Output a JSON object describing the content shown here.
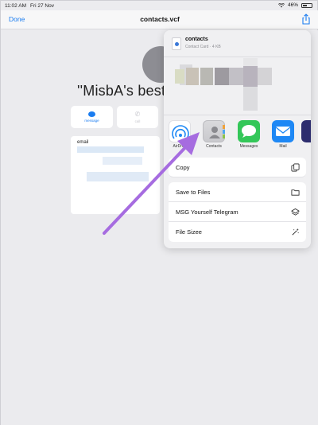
{
  "status_bar": {
    "time": "11:02 AM",
    "date": "Fri 27 Nov",
    "battery": "46%"
  },
  "nav": {
    "done_label": "Done",
    "title": "contacts.vcf"
  },
  "contact": {
    "name": "''MisbA's best * (",
    "message_label": "message",
    "call_label": "call",
    "email_label": "email"
  },
  "share_sheet": {
    "file_name": "contacts",
    "file_meta": "Contact Card · 4 KB",
    "apps": [
      {
        "label": "AirDrop"
      },
      {
        "label": "Contacts"
      },
      {
        "label": "Messages"
      },
      {
        "label": "Mail"
      }
    ],
    "actions": [
      {
        "label": "Copy",
        "icon": "copy-icon"
      },
      {
        "label": "Save to Files",
        "icon": "folder-icon"
      },
      {
        "label": "MSG Yourself Telegram",
        "icon": "layers-icon"
      },
      {
        "label": "File Sizee",
        "icon": "magic-wand-icon"
      }
    ]
  },
  "colors": {
    "accent": "#1a7cf0",
    "annotation_arrow": "#a66ce0",
    "messages_green": "#34c759",
    "mail_blue": "#1e88f5"
  }
}
